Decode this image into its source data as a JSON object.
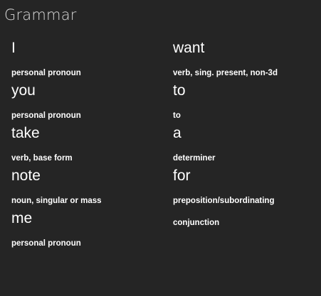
{
  "panel": {
    "title": "Grammar"
  },
  "tokens_left": [
    {
      "word": "I",
      "tag": "personal pronoun"
    },
    {
      "word": "you",
      "tag": "personal pronoun"
    },
    {
      "word": "take",
      "tag": "verb, base form"
    },
    {
      "word": "note",
      "tag": "noun, singular or mass"
    },
    {
      "word": "me",
      "tag": "personal pronoun"
    }
  ],
  "tokens_right": [
    {
      "word": "want",
      "tag": "verb, sing. present, non-3d"
    },
    {
      "word": "to",
      "tag": "to"
    },
    {
      "word": "a",
      "tag": "determiner"
    },
    {
      "word": "for",
      "tag": "preposition/subordinating"
    }
  ],
  "tag_continuation": "conjunction"
}
